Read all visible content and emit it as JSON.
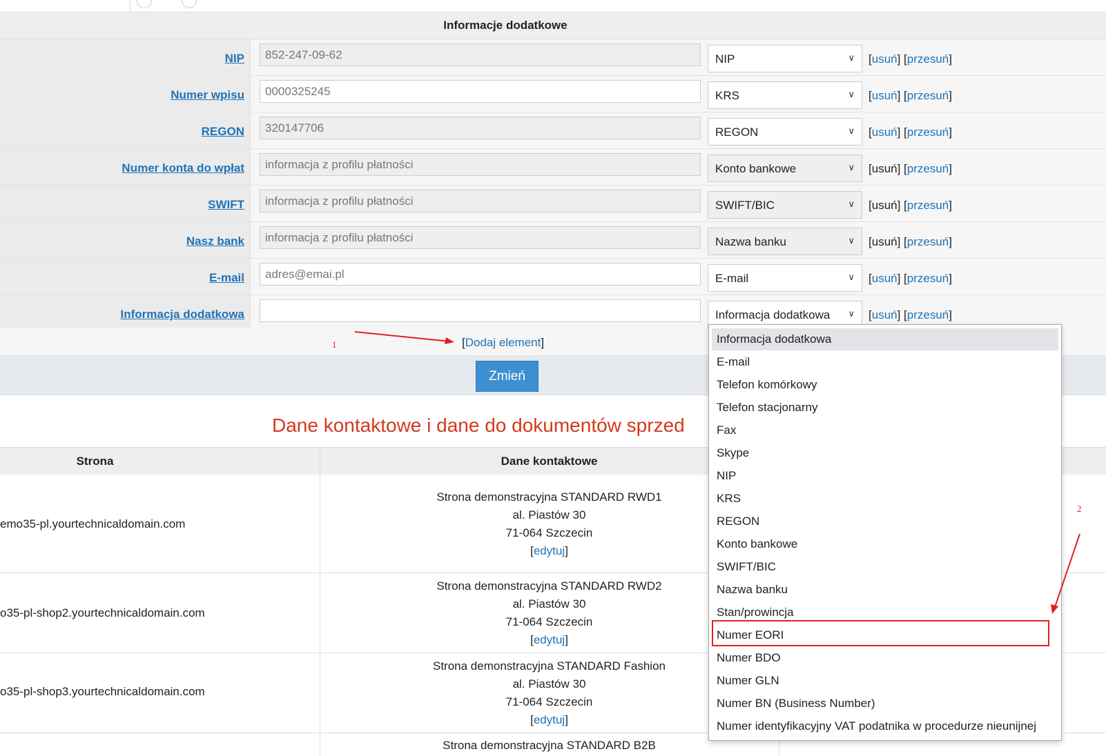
{
  "section_title": "Informacje dodatkowe",
  "fields": [
    {
      "label": "NIP",
      "value": "852-247-09-62",
      "type": "NIP",
      "remove": "usuń",
      "move": "przesuń",
      "readonly": true
    },
    {
      "label": "Numer wpisu",
      "value": "0000325245",
      "type": "KRS",
      "remove": "usuń",
      "move": "przesuń",
      "readonly": false
    },
    {
      "label": "REGON",
      "value": "320147706",
      "type": "REGON",
      "remove": "usuń",
      "move": "przesuń",
      "readonly": true
    },
    {
      "label": "Numer konta do wpłat",
      "value": "informacja z profilu płatności",
      "type": "Konto bankowe",
      "remove": "usuń",
      "move": "przesuń",
      "readonly": true
    },
    {
      "label": "SWIFT",
      "value": "informacja z profilu płatności",
      "type": "SWIFT/BIC",
      "remove": "usuń",
      "move": "przesuń",
      "readonly": true
    },
    {
      "label": "Nasz bank",
      "value": "informacja z profilu płatności",
      "type": "Nazwa banku",
      "remove": "usuń",
      "move": "przesuń",
      "readonly": true
    },
    {
      "label": "E-mail",
      "value": "adres@emai.pl",
      "type": "E-mail",
      "remove": "usuń",
      "move": "przesuń",
      "readonly": false
    },
    {
      "label": "Informacja dodatkowa",
      "value": "",
      "type": "Informacja dodatkowa",
      "remove": "usuń",
      "move": "przesuń",
      "readonly": false
    }
  ],
  "add_element": "Dodaj element",
  "submit_label": "Zmień",
  "annotations": {
    "one": "1",
    "two": "2"
  },
  "contact_title": "Dane kontaktowe i dane do dokumentów sprzed",
  "table": {
    "headers": [
      "Strona",
      "Dane kontaktowe"
    ],
    "rows": [
      {
        "domain": "emo35-pl.yourtechnicaldomain.com",
        "name": "Strona demonstracyjna STANDARD RWD1",
        "street": "al. Piastów 30",
        "city": "71-064 Szczecin",
        "edit": "edytuj"
      },
      {
        "domain": "o35-pl-shop2.yourtechnicaldomain.com",
        "name": "Strona demonstracyjna STANDARD RWD2",
        "street": "al. Piastów 30",
        "city": "71-064 Szczecin",
        "edit": "edytuj"
      },
      {
        "domain": "o35-pl-shop3.yourtechnicaldomain.com",
        "name": "Strona demonstracyjna STANDARD Fashion",
        "street": "al. Piastów 30",
        "city": "71-064 Szczecin",
        "edit": "edytuj"
      },
      {
        "domain": "",
        "name": "Strona demonstracyjna STANDARD B2B"
      }
    ]
  },
  "dropdown_options": [
    "Informacja dodatkowa",
    "E-mail",
    "Telefon komórkowy",
    "Telefon stacjonarny",
    "Fax",
    "Skype",
    "NIP",
    "KRS",
    "REGON",
    "Konto bankowe",
    "SWIFT/BIC",
    "Nazwa banku",
    "Stan/prowincja",
    "Numer EORI",
    "Numer BDO",
    "Numer GLN",
    "Numer BN (Business Number)",
    "Numer identyfikacyjny VAT podatnika w procedurze nieunijnej"
  ],
  "dropdown_highlighted": "Informacja dodatkowa",
  "dropdown_marked": "Numer EORI",
  "colors": {
    "link": "#1f73b7",
    "button": "#3d8fd1",
    "title_red": "#d5381c",
    "annotation": "#e02020"
  }
}
